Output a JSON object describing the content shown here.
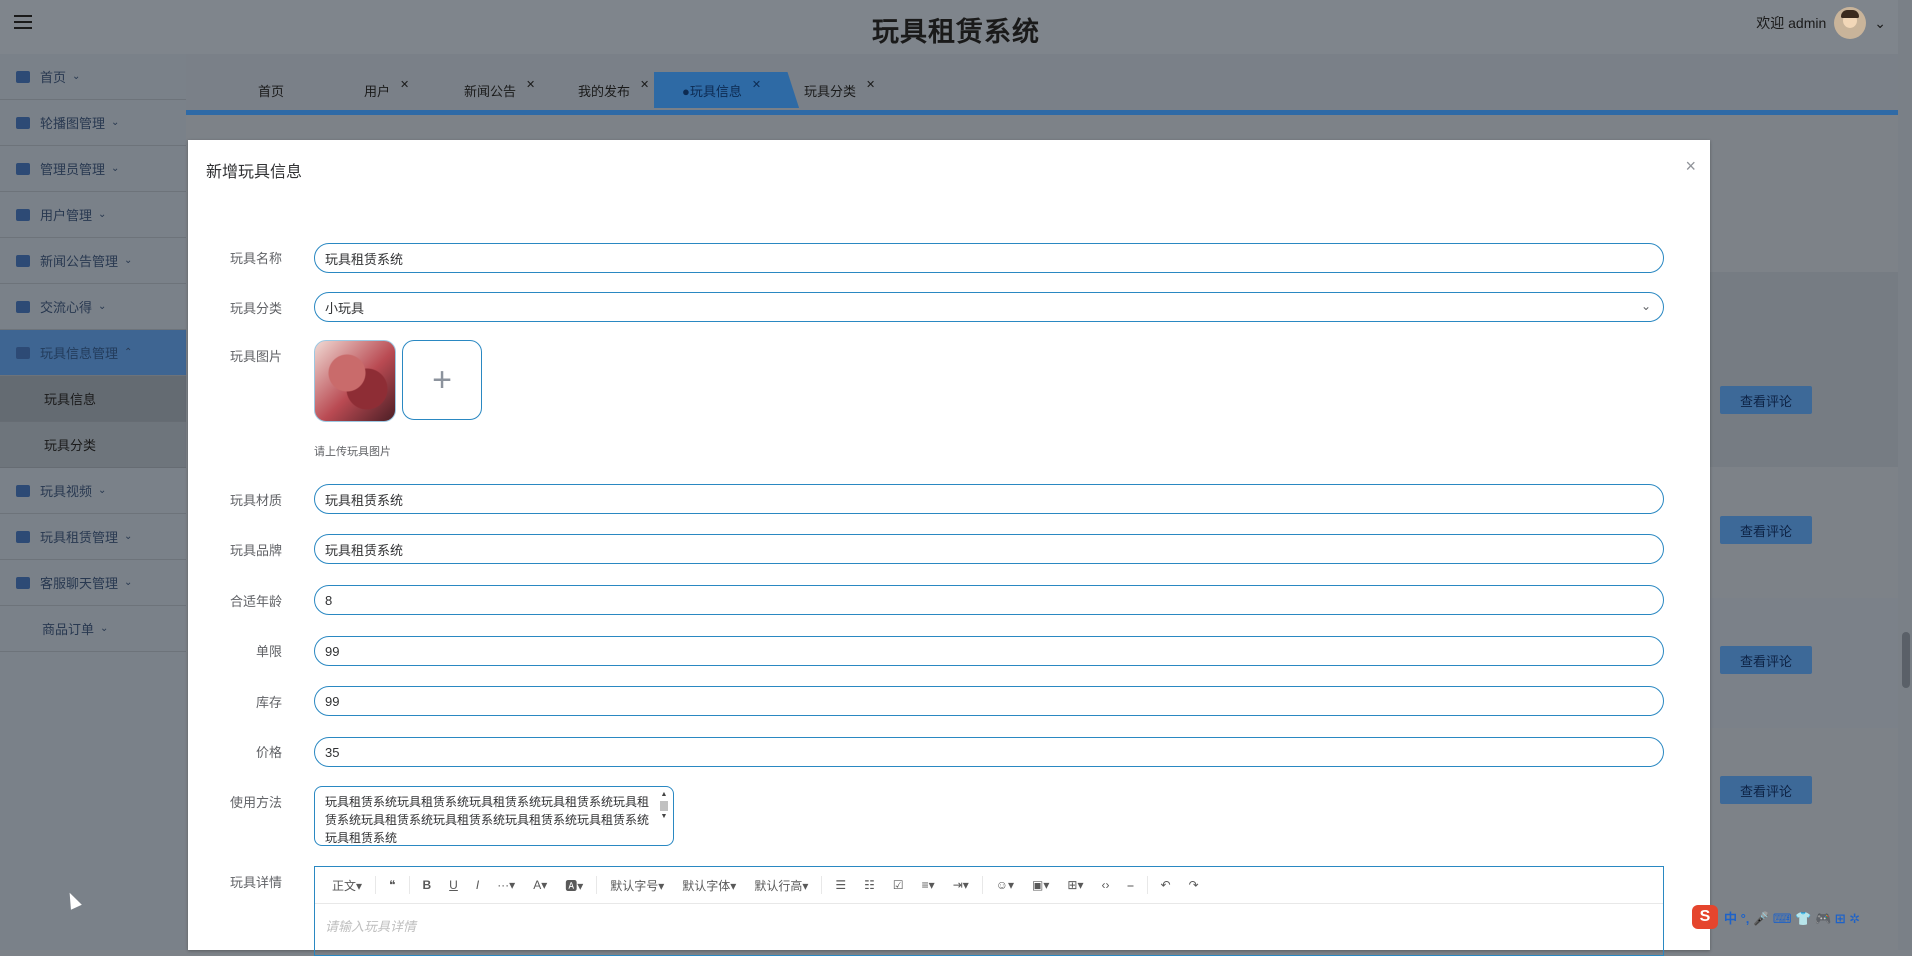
{
  "header": {
    "title": "玩具租赁系统",
    "welcome": "欢迎 admin",
    "menu_icon": "hamburger-icon"
  },
  "sidebar": {
    "items": [
      {
        "label": "首页",
        "icon": "home-icon"
      },
      {
        "label": "轮播图管理",
        "icon": "carousel-icon"
      },
      {
        "label": "管理员管理",
        "icon": "admin-icon"
      },
      {
        "label": "用户管理",
        "icon": "user-icon"
      },
      {
        "label": "新闻公告管理",
        "icon": "news-icon"
      },
      {
        "label": "交流心得",
        "icon": "chat-icon"
      },
      {
        "label": "玩具信息管理",
        "icon": "grid-icon"
      },
      {
        "label": "玩具视频",
        "icon": "video-icon"
      },
      {
        "label": "玩具租赁管理",
        "icon": "rent-icon"
      },
      {
        "label": "客服聊天管理",
        "icon": "service-icon"
      },
      {
        "label": "商品订单",
        "icon": ""
      }
    ],
    "subitems": [
      {
        "label": "玩具信息"
      },
      {
        "label": "玩具分类"
      }
    ]
  },
  "tabs": [
    {
      "label": "首页",
      "closable": false
    },
    {
      "label": "用户",
      "closable": true
    },
    {
      "label": "新闻公告",
      "closable": true
    },
    {
      "label": "我的发布",
      "closable": true
    },
    {
      "label": "●玩具信息",
      "closable": true,
      "active": true
    },
    {
      "label": "玩具分类",
      "closable": true
    }
  ],
  "background_buttons": {
    "label": "查看评论"
  },
  "dialog": {
    "title": "新增玩具信息",
    "close": "×",
    "fields": {
      "name": {
        "label": "玩具名称",
        "value": "玩具租赁系统"
      },
      "category": {
        "label": "玩具分类",
        "value": "小玩具"
      },
      "image": {
        "label": "玩具图片",
        "tip": "请上传玩具图片",
        "add": "+"
      },
      "material": {
        "label": "玩具材质",
        "value": "玩具租赁系统"
      },
      "brand": {
        "label": "玩具品牌",
        "value": "玩具租赁系统"
      },
      "age": {
        "label": "合适年龄",
        "value": "8"
      },
      "limit": {
        "label": "单限",
        "value": "99"
      },
      "stock": {
        "label": "库存",
        "value": "99"
      },
      "price": {
        "label": "价格",
        "value": "35"
      },
      "usage": {
        "label": "使用方法",
        "value": "玩具租赁系统玩具租赁系统玩具租赁系统玩具租赁系统玩具租赁系统玩具租赁系统玩具租赁系统玩具租赁系统玩具租赁系统玩具租赁系统"
      },
      "detail": {
        "label": "玩具详情",
        "placeholder": "请输入玩具详情"
      }
    },
    "toolbar": [
      "正文▾",
      "❝",
      "B",
      "U",
      "I",
      "···▾",
      "A▾",
      "🅰▾",
      "默认字号▾",
      "默认字体▾",
      "默认行高▾",
      "☰",
      "☷",
      "☑",
      "≡▾",
      "⇥▾",
      "☺▾",
      "▣▾",
      "⊞▾",
      "‹›",
      "⎯",
      "↶",
      "↷"
    ]
  },
  "ime": {
    "logo": "S",
    "text": "中 °, 🎤 ⌨ 👕 🎮 ⊞ ✲"
  }
}
